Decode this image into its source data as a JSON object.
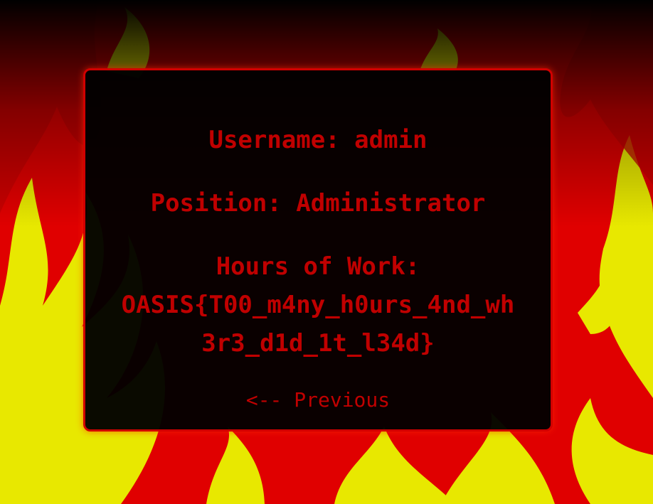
{
  "profile": {
    "username_line": "Username: admin",
    "position_line": "Position: Administrator",
    "hours_label": "Hours of Work:",
    "flag_line_1": "OASIS{T00_m4ny_h0urs_4nd_wh",
    "flag_line_2": "3r3_d1d_1t_l34d}"
  },
  "navigation": {
    "previous_label": "<-- Previous"
  },
  "colors": {
    "text_red": "#c00000",
    "card_border": "#d10000",
    "flame_red": "#e00000",
    "flame_yellow": "#e8e800",
    "card_background": "#000000"
  }
}
